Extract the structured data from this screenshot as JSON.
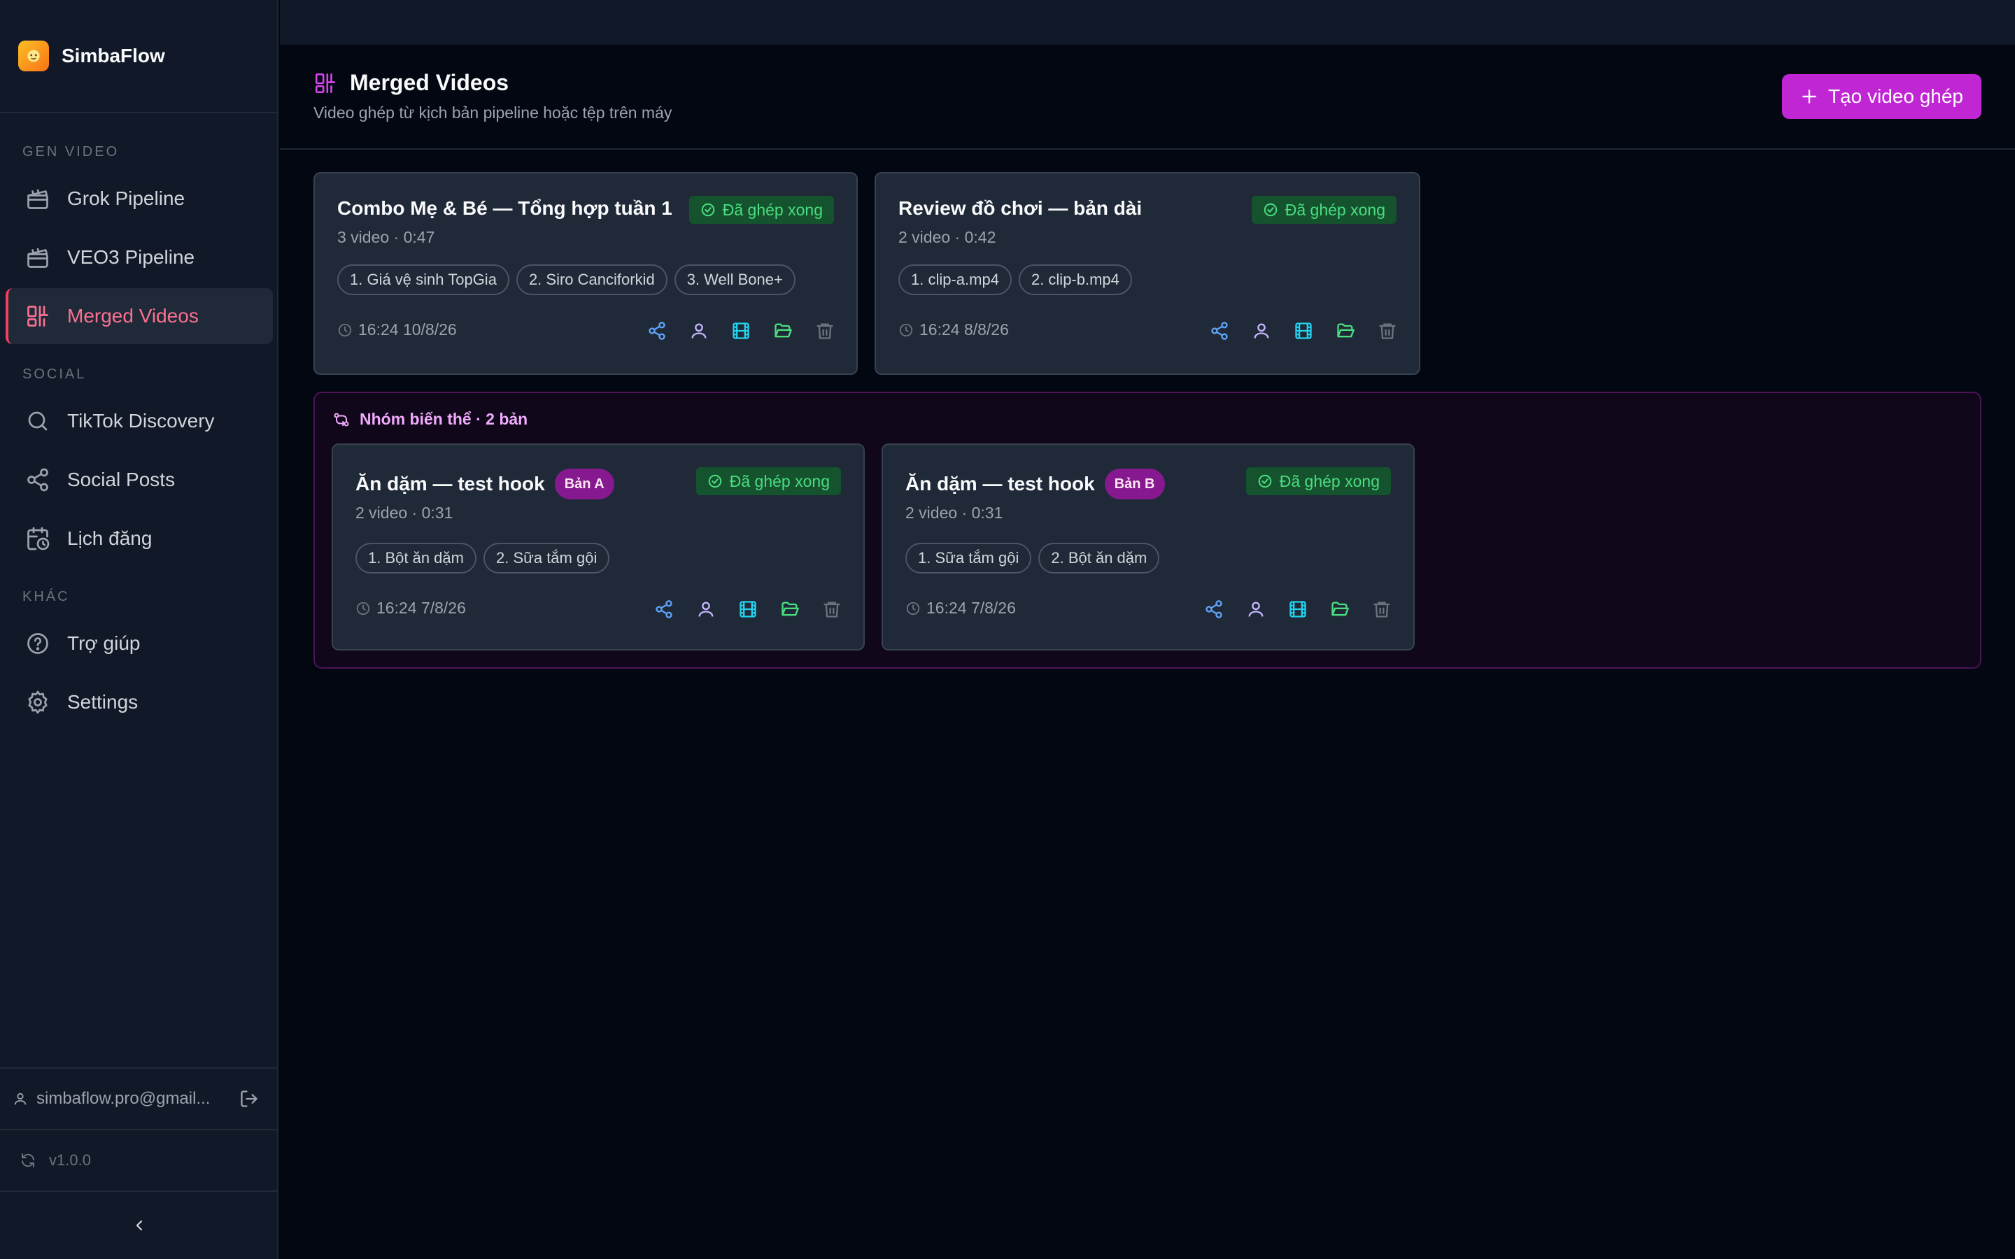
{
  "app": {
    "name": "SimbaFlow",
    "version": "v1.0.0"
  },
  "sidebar": {
    "sections": [
      {
        "label": "GEN VIDEO"
      },
      {
        "label": "SOCIAL"
      },
      {
        "label": "KHÁC"
      }
    ],
    "items": [
      {
        "label": "Grok Pipeline",
        "icon": "clapperboard-icon"
      },
      {
        "label": "VEO3 Pipeline",
        "icon": "clapperboard-icon"
      },
      {
        "label": "Merged Videos",
        "icon": "merge-icon",
        "active": true
      },
      {
        "label": "TikTok Discovery",
        "icon": "search-icon"
      },
      {
        "label": "Social Posts",
        "icon": "share-icon"
      },
      {
        "label": "Lịch đăng",
        "icon": "calendar-clock-icon"
      },
      {
        "label": "Trợ giúp",
        "icon": "help-circle-icon"
      },
      {
        "label": "Settings",
        "icon": "gear-icon"
      }
    ],
    "user_email": "simbaflow.pro@gmail..."
  },
  "header": {
    "title": "Merged Videos",
    "subtitle": "Video ghép từ kịch bản pipeline hoặc tệp trên máy",
    "create_button": "Tạo video ghép"
  },
  "cards": [
    {
      "title": "Combo Mẹ & Bé — Tổng hợp tuần 1",
      "meta": "3 video · 0:47",
      "status": "Đã ghép xong",
      "chips": [
        "1. Giá vệ sinh TopGia",
        "2. Siro Canciforkid",
        "3. Well Bone+"
      ],
      "time": "16:24 10/8/26"
    },
    {
      "title": "Review đồ chơi — bản dài",
      "meta": "2 video · 0:42",
      "status": "Đã ghép xong",
      "chips": [
        "1. clip-a.mp4",
        "2. clip-b.mp4"
      ],
      "time": "16:24 8/8/26"
    }
  ],
  "variant_group": {
    "label": "Nhóm biến thể · 2 bản",
    "cards": [
      {
        "title": "Ăn dặm — test hook",
        "variant": "Bản A",
        "meta": "2 video · 0:31",
        "status": "Đã ghép xong",
        "chips": [
          "1. Bột ăn dặm",
          "2. Sữa tắm gội"
        ],
        "time": "16:24 7/8/26"
      },
      {
        "title": "Ăn dặm — test hook",
        "variant": "Bản B",
        "meta": "2 video · 0:31",
        "status": "Đã ghép xong",
        "chips": [
          "1. Sữa tắm gội",
          "2. Bột ăn dặm"
        ],
        "time": "16:24 7/8/26"
      }
    ]
  },
  "colors": {
    "accent": "#c026d3",
    "active_nav": "#f87192",
    "success": "#4ade80",
    "share": "#60a5fa",
    "user": "#c4b5fd",
    "film": "#22d3ee",
    "folder": "#4ade80",
    "trash": "#6b7280"
  }
}
